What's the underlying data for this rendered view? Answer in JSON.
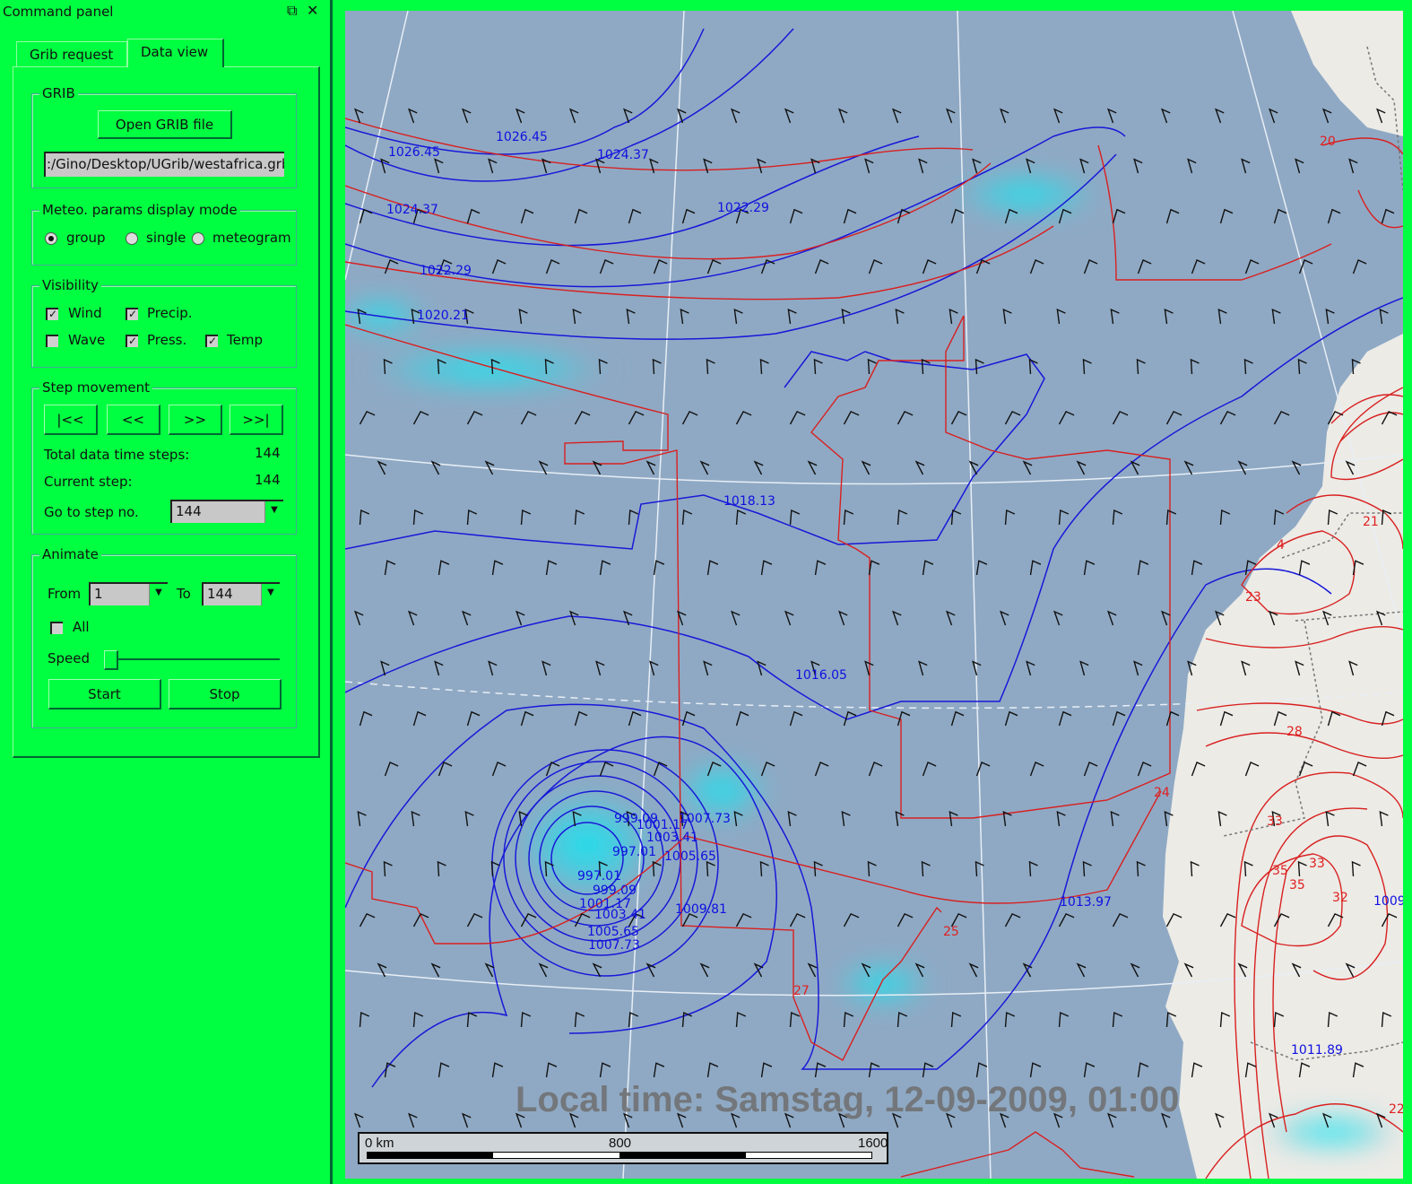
{
  "panel": {
    "title": "Command panel",
    "float_icon": "⧉",
    "close_icon": "✕",
    "tabs": [
      {
        "label": "Grib request",
        "active": false
      },
      {
        "label": "Data view",
        "active": true
      }
    ],
    "grib": {
      "group_label": "GRIB",
      "open_button": "Open GRIB file",
      "file_path": ":/Gino/Desktop/UGrib/westafrica.grb"
    },
    "display_mode": {
      "group_label": "Meteo. params display mode",
      "options": [
        {
          "label": "group",
          "selected": true
        },
        {
          "label": "single",
          "selected": false
        },
        {
          "label": "meteogram",
          "selected": false
        }
      ]
    },
    "visibility": {
      "group_label": "Visibility",
      "items": [
        {
          "label": "Wind",
          "checked": true
        },
        {
          "label": "Precip.",
          "checked": true
        },
        {
          "label": "Wave",
          "checked": false
        },
        {
          "label": "Press.",
          "checked": true
        },
        {
          "label": "Temp",
          "checked": true
        }
      ]
    },
    "step": {
      "group_label": "Step movement",
      "buttons": [
        "|<<",
        "<<",
        ">>",
        ">>|"
      ],
      "total_label": "Total data time steps:",
      "total_value": "144",
      "current_label": "Current step:",
      "current_value": "144",
      "goto_label": "Go to step no.",
      "goto_value": "144"
    },
    "animate": {
      "group_label": "Animate",
      "from_label": "From",
      "from_value": "1",
      "to_label": "To",
      "to_value": "144",
      "all_label": "All",
      "all_checked": false,
      "speed_label": "Speed",
      "speed_value": 0.0,
      "start_button": "Start",
      "stop_button": "Stop"
    }
  },
  "map": {
    "local_time": "Local time: Samstag, 12-09-2009, 01:00",
    "scale": {
      "start": "0 km",
      "mid": "800",
      "end": "1600"
    },
    "pressure_labels": [
      "1026.45",
      "1026.45",
      "1024.37",
      "1022.29",
      "1024.37",
      "1022.29",
      "1020.21",
      "1018.13",
      "1016.05",
      "1013.97",
      "1011.89",
      "1009",
      "999.09",
      "1001.17",
      "1007.73",
      "1003.41",
      "997.01",
      "1005.65",
      "997.01",
      "999.09",
      "1001.17",
      "1003.41",
      "1005.65",
      "1007.73",
      "1009.81"
    ],
    "temp_labels": [
      "20",
      "21",
      "4",
      "23",
      "28",
      "24",
      "33",
      "35",
      "35",
      "33",
      "32",
      "25",
      "27",
      "22"
    ],
    "colors": {
      "sea": "#8fa9c4",
      "land": "#ecebe6",
      "pressure": "#1010e0",
      "temperature": "#e02020",
      "precip": "#00e8f0"
    }
  }
}
